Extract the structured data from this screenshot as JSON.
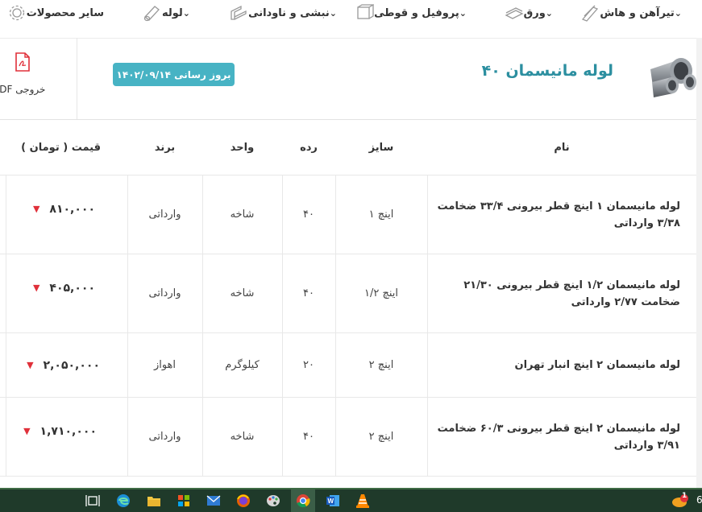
{
  "nav": {
    "items": [
      {
        "label": "تیرآهن و هاش",
        "icon": "beam-icon",
        "has_dropdown": true
      },
      {
        "label": "ورق",
        "icon": "sheet-icon",
        "has_dropdown": true
      },
      {
        "label": "پروفیل و قوطی",
        "icon": "profile-icon",
        "has_dropdown": true
      },
      {
        "label": "نبشی و ناودانی",
        "icon": "angle-icon",
        "has_dropdown": true
      },
      {
        "label": "لوله",
        "icon": "pipe-icon",
        "has_dropdown": true
      },
      {
        "label": "سایر محصولات",
        "icon": "gear-icon",
        "has_dropdown": false
      }
    ]
  },
  "header": {
    "title": "لوله مانیسمان ۴۰",
    "updated_badge": "بروز رسانی ۱۴۰۲/۰۹/۱۴",
    "pdf_label": "خروجی PDF"
  },
  "table": {
    "columns": {
      "name": "نام",
      "size": "سایز",
      "grade": "رده",
      "unit": "واحد",
      "brand": "برند",
      "price": "قیمت ( تومان )"
    },
    "rows": [
      {
        "name": "لوله مانیسمان ۱ اینچ قطر بیرونی ۳۳/۴ ضخامت ۳/۳۸ وارداتی",
        "size": "۱ اینچ",
        "grade": "۴۰",
        "unit": "شاخه",
        "brand": "وارداتی",
        "price": "۸۱۰,۰۰۰",
        "trend": "down"
      },
      {
        "name": "لوله مانیسمان ۱/۲ اینچ قطر بیرونی ۲۱/۳۰ ضخامت ۲/۷۷ وارداتی",
        "size": "۱/۲ اینچ",
        "grade": "۴۰",
        "unit": "شاخه",
        "brand": "وارداتی",
        "price": "۴۰۵,۰۰۰",
        "trend": "down"
      },
      {
        "name": "لوله مانیسمان ۲ اینچ انبار تهران",
        "size": "۲ اینچ",
        "grade": "۲۰",
        "unit": "کیلوگرم",
        "brand": "اهواز",
        "price": "۲,۰۵۰,۰۰۰",
        "trend": "down"
      },
      {
        "name": "لوله مانیسمان ۲ اینچ قطر بیرونی ۶۰/۳ ضخامت ۳/۹۱ وارداتی",
        "size": "۲ اینچ",
        "grade": "۴۰",
        "unit": "شاخه",
        "brand": "وارداتی",
        "price": "۱,۷۱۰,۰۰۰",
        "trend": "down"
      }
    ]
  },
  "taskbar": {
    "apps": [
      "task-view-icon",
      "edge-icon",
      "file-explorer-icon",
      "store-icon",
      "mail-icon",
      "firefox-icon",
      "paint-icon",
      "chrome-icon",
      "word-icon",
      "vlc-icon"
    ],
    "notification_count": "1",
    "edge_char": "6"
  },
  "colors": {
    "accent": "#2c8fa0",
    "badge": "#47b3c4",
    "price_down": "#e0303a",
    "taskbar": "#1f3a2a"
  }
}
